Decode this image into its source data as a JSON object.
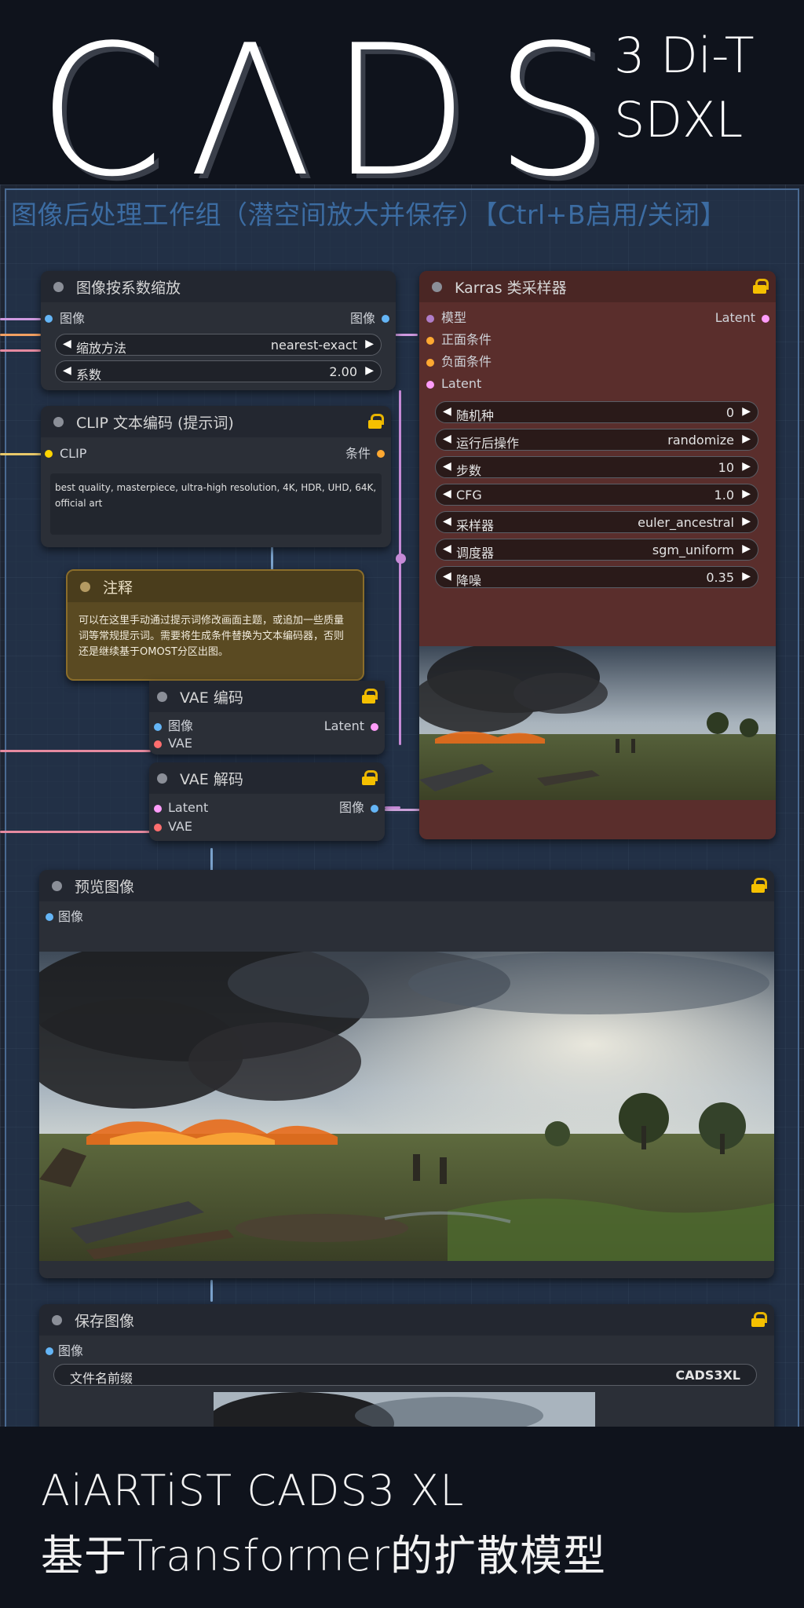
{
  "banner": {
    "letters": [
      "C",
      "Λ",
      "D",
      "S"
    ],
    "line1": "3 Di-T",
    "line2": "SDXL"
  },
  "group": {
    "title": "图像后处理工作组（潜空间放大并保存）【Ctrl+B启用/关闭】"
  },
  "nodes": {
    "scale": {
      "title": "图像按系数缩放",
      "input": "图像",
      "output": "图像",
      "widgets": [
        {
          "label": "缩放方法",
          "value": "nearest-exact"
        },
        {
          "label": "系数",
          "value": "2.00"
        }
      ]
    },
    "clip": {
      "title": "CLIP 文本编码 (提示词)",
      "input": "CLIP",
      "output": "条件",
      "text": "best quality, masterpiece, ultra-high resolution, 4K, HDR, UHD, 64K, official art"
    },
    "note": {
      "title": "注释",
      "text": "可以在这里手动通过提示词修改画面主题，或追加一些质量词等常规提示词。需要将生成条件替换为文本编码器，否则还是继续基于OMOST分区出图。"
    },
    "vae_enc": {
      "title": "VAE 编码",
      "inputs": [
        "图像",
        "VAE"
      ],
      "output": "Latent"
    },
    "vae_dec": {
      "title": "VAE 解码",
      "inputs": [
        "Latent",
        "VAE"
      ],
      "output": "图像"
    },
    "sampler": {
      "title": "Karras 类采样器",
      "inputs": [
        "模型",
        "正面条件",
        "负面条件",
        "Latent"
      ],
      "output": "Latent",
      "widgets": [
        {
          "label": "随机种",
          "value": "0"
        },
        {
          "label": "运行后操作",
          "value": "randomize"
        },
        {
          "label": "步数",
          "value": "10"
        },
        {
          "label": "CFG",
          "value": "1.0"
        },
        {
          "label": "采样器",
          "value": "euler_ancestral"
        },
        {
          "label": "调度器",
          "value": "sgm_uniform"
        },
        {
          "label": "降噪",
          "value": "0.35"
        }
      ]
    },
    "preview": {
      "title": "预览图像",
      "input": "图像"
    },
    "save": {
      "title": "保存图像",
      "input": "图像",
      "widget": {
        "label": "文件名前缀",
        "value": "CADS3XL"
      }
    }
  },
  "footer": {
    "line1": "AiARTiST CADS3 XL",
    "line2": "基于Transformer的扩散模型"
  },
  "colors": {
    "bg": "#0f131c",
    "canvas": "#1e2533",
    "group_title": "#3c6ca2",
    "node_body": "#2b2f37",
    "sampler_body": "#5a2e2c",
    "note_body": "#5a4a22",
    "lock": "#f5c000",
    "image_slot": "#64b5f6",
    "latent_slot": "#ff9cf9",
    "conditioning_slot": "#ffa931",
    "clip_slot": "#ffd500",
    "vae_slot": "#ff6e6e"
  }
}
